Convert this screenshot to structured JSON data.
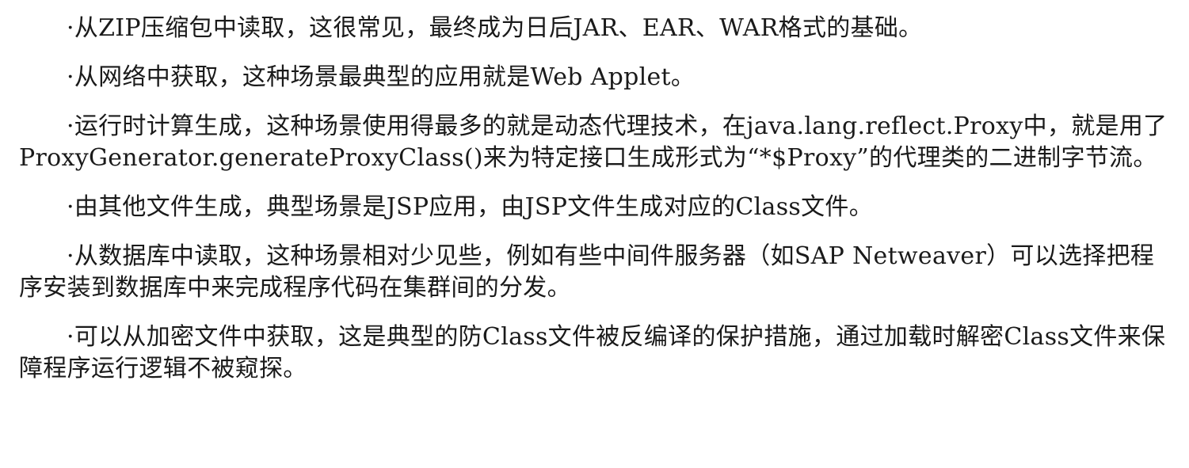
{
  "paragraphs": [
    "·从ZIP压缩包中读取，这很常见，最终成为日后JAR、EAR、WAR格式的基础。",
    "·从网络中获取，这种场景最典型的应用就是Web Applet。",
    "·运行时计算生成，这种场景使用得最多的就是动态代理技术，在java.lang.reflect.Proxy中，就是用了ProxyGenerator.generateProxyClass()来为特定接口生成形式为“*$Proxy”的代理类的二进制字节流。",
    "·由其他文件生成，典型场景是JSP应用，由JSP文件生成对应的Class文件。",
    "·从数据库中读取，这种场景相对少见些，例如有些中间件服务器（如SAP Netweaver）可以选择把程序安装到数据库中来完成程序代码在集群间的分发。",
    "·可以从加密文件中获取，这是典型的防Class文件被反编译的保护措施，通过加载时解密Class文件来保障程序运行逻辑不被窥探。"
  ]
}
